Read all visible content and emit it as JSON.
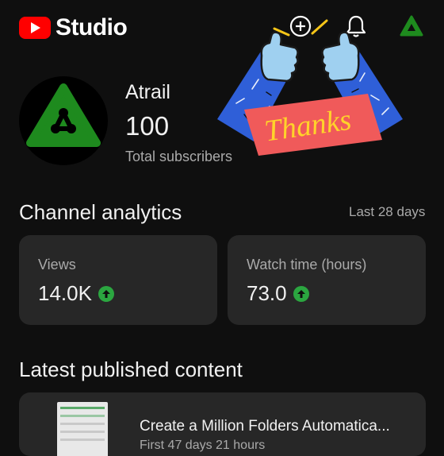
{
  "header": {
    "logo_text": "Studio",
    "icons": [
      "youtube-logo-icon",
      "create-plus-icon",
      "notifications-bell-icon",
      "channel-avatar-icon"
    ]
  },
  "channel": {
    "name": "Atrail",
    "subscribers": "100",
    "subscribers_label": "Total subscribers"
  },
  "sticker": {
    "text": "Thanks"
  },
  "analytics": {
    "title": "Channel analytics",
    "period": "Last 28 days",
    "cards": [
      {
        "label": "Views",
        "value": "14.0K",
        "trend": "up"
      },
      {
        "label": "Watch time (hours)",
        "value": "73.0",
        "trend": "up"
      }
    ]
  },
  "latest": {
    "title": "Latest published content",
    "video_title": "Create a Million Folders Automatica...",
    "video_sub": "First 47 days 21 hours"
  },
  "colors": {
    "background": "#0f0f0f",
    "card": "#272727",
    "brand_red": "#ff0000",
    "trend_green": "#2ba640",
    "avatar_green": "#1e8a1e"
  }
}
